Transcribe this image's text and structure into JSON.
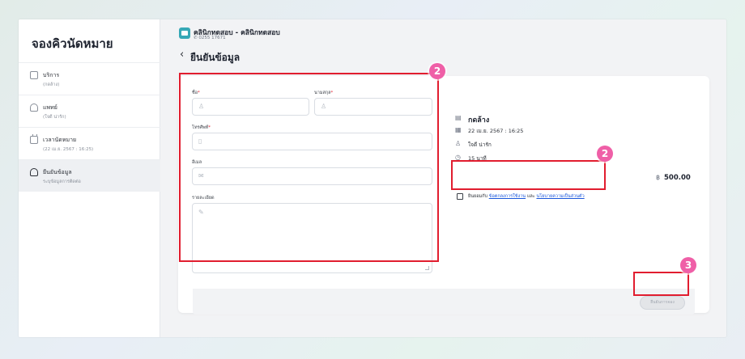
{
  "sidebar": {
    "title": "จองคิวนัดหมาย",
    "items": [
      {
        "label": "บริการ",
        "sub": "(กดล้าง)",
        "icon": "service-icon"
      },
      {
        "label": "แพทย์",
        "sub": "(ใจดี น่ารัก)",
        "icon": "doctor-icon"
      },
      {
        "label": "เวลานัดหมาย",
        "sub": "(22 เม.ย. 2567 : 16:25)",
        "icon": "calendar-icon"
      },
      {
        "label": "ยืนยันข้อมูล",
        "sub": "ระบุข้อมูลการติดต่อ",
        "icon": "user-icon"
      }
    ]
  },
  "header": {
    "clinic_name": "คลินิกทดสอบ - คลินิกทดสอบ",
    "clinic_phone": "0255 17671",
    "page_title": "ยืนยันข้อมูล"
  },
  "form": {
    "first_name_label": "ชื่อ",
    "last_name_label": "นามสกุล",
    "phone_label": "โทรศัพท์",
    "email_label": "อีเมล",
    "details_label": "รายละเอียด",
    "required_mark": "*"
  },
  "summary": {
    "service": "กดล้าง",
    "datetime": "22 เม.ย. 2567 : 16:25",
    "doctor": "ใจดี น่ารัก",
    "duration": "15 นาที",
    "price": "500.00",
    "currency_symbol": "฿"
  },
  "consent": {
    "prefix": "ยินยอมกับ",
    "terms_link": "ข้อตกลงการใช้งาน",
    "and": "และ",
    "privacy_link": "นโยบายความเป็นส่วนตัว"
  },
  "footer": {
    "confirm_label": "ยืนยันการจอง"
  },
  "annotations": {
    "badge_form": "2",
    "badge_consent": "2",
    "badge_confirm": "3",
    "box_color": "#e11d2f",
    "badge_color": "#ef5fa7"
  }
}
